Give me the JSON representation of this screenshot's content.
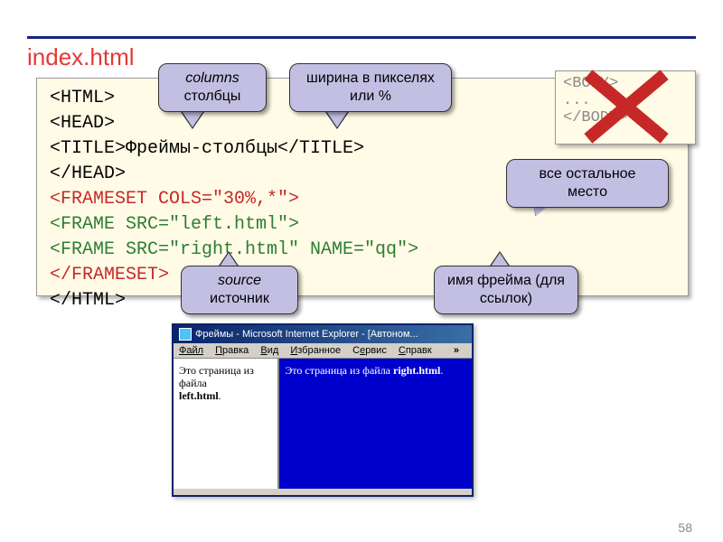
{
  "page": {
    "title_filename": "index.html",
    "page_number": "58"
  },
  "code": {
    "l1": "<HTML>",
    "l2": "<HEAD>",
    "l3a": "    <TITLE>",
    "l3b": "Фреймы-столбцы",
    "l3c": "</TITLE>",
    "l4": "</HEAD>",
    "l5": "<FRAMESET COLS=\"30%,*\">",
    "l6": "    <FRAME SRC=\"left.html\">",
    "l7": "    <FRAME SRC=\"right.html\" NAME=\"qq\">",
    "l8": "</FRAMESET>",
    "l9": "</HTML>"
  },
  "callouts": {
    "columns_en": "columns",
    "columns_ru": "столбцы",
    "width": "ширина в пикселях или %",
    "rest": "все остальное место",
    "source_en": "source",
    "source_ru": "источник",
    "name": "имя фрейма (для ссылок)"
  },
  "bad": {
    "l1": "<BODY>",
    "l2": "...",
    "l3": "</BODY>"
  },
  "ie": {
    "title": "Фреймы - Microsoft Internet Explorer - [Автоном...",
    "menu_file": "Файл",
    "menu_edit": "Правка",
    "menu_view": "Вид",
    "menu_fav": "Избранное",
    "menu_svc": "Сервис",
    "menu_help": "Справк",
    "left_text": "Это страница из файла",
    "left_bold": "left.html",
    "right_text": "Это страница из файла",
    "right_bold": "right.html"
  }
}
